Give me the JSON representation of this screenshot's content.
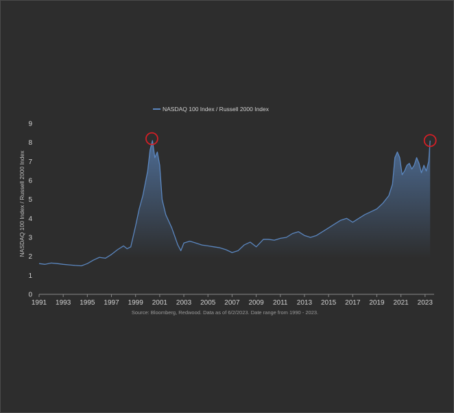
{
  "chart_data": {
    "type": "area",
    "title": "",
    "xlabel": "",
    "ylabel": "NASDAQ 100 Index / Russell 2000 Index",
    "xlim": [
      1991,
      2023.75
    ],
    "ylim": [
      0,
      9
    ],
    "x_ticks": [
      "1991",
      "1993",
      "1995",
      "1997",
      "1999",
      "2001",
      "2003",
      "2005",
      "2007",
      "2009",
      "2011",
      "2013",
      "2015",
      "2017",
      "2019",
      "2021",
      "2023"
    ],
    "y_ticks": [
      "0",
      "1",
      "2",
      "3",
      "4",
      "5",
      "6",
      "7",
      "8",
      "9"
    ],
    "grid": false,
    "legend": "top-center",
    "source": "Source: Bloomberg, Redwood. Data as of 6/2/2023. Date range from 1990 - 2023.",
    "series": [
      {
        "name": "NASDAQ 100 Index / Russell 2000 Index",
        "color": "#5b87c0",
        "x": [
          1991.0,
          1991.5,
          1992.0,
          1992.5,
          1993.0,
          1993.5,
          1994.0,
          1994.5,
          1995.0,
          1995.5,
          1996.0,
          1996.5,
          1997.0,
          1997.5,
          1998.0,
          1998.3,
          1998.6,
          1999.0,
          1999.3,
          1999.6,
          2000.0,
          2000.2,
          2000.4,
          2000.6,
          2000.8,
          2001.0,
          2001.2,
          2001.5,
          2002.0,
          2002.5,
          2002.75,
          2003.0,
          2003.5,
          2004.0,
          2004.5,
          2005.0,
          2005.5,
          2006.0,
          2006.5,
          2007.0,
          2007.5,
          2008.0,
          2008.5,
          2009.0,
          2009.3,
          2009.6,
          2010.0,
          2010.5,
          2011.0,
          2011.5,
          2012.0,
          2012.5,
          2013.0,
          2013.5,
          2014.0,
          2014.5,
          2015.0,
          2015.5,
          2016.0,
          2016.5,
          2017.0,
          2017.5,
          2018.0,
          2018.5,
          2019.0,
          2019.5,
          2020.0,
          2020.3,
          2020.5,
          2020.7,
          2020.9,
          2021.1,
          2021.3,
          2021.5,
          2021.7,
          2021.9,
          2022.1,
          2022.3,
          2022.5,
          2022.7,
          2022.9,
          2023.1,
          2023.3,
          2023.42
        ],
        "values": [
          1.62,
          1.58,
          1.65,
          1.62,
          1.58,
          1.55,
          1.52,
          1.5,
          1.62,
          1.8,
          1.95,
          1.9,
          2.1,
          2.35,
          2.55,
          2.4,
          2.5,
          3.6,
          4.5,
          5.2,
          6.5,
          7.6,
          8.1,
          7.2,
          7.5,
          6.8,
          5.0,
          4.2,
          3.5,
          2.6,
          2.3,
          2.7,
          2.8,
          2.7,
          2.6,
          2.55,
          2.5,
          2.45,
          2.35,
          2.2,
          2.3,
          2.6,
          2.75,
          2.5,
          2.7,
          2.9,
          2.9,
          2.85,
          2.95,
          3.0,
          3.2,
          3.3,
          3.1,
          3.0,
          3.1,
          3.3,
          3.5,
          3.7,
          3.9,
          4.0,
          3.8,
          4.0,
          4.2,
          4.35,
          4.5,
          4.8,
          5.2,
          5.8,
          7.2,
          7.5,
          7.2,
          6.3,
          6.5,
          6.8,
          6.9,
          6.6,
          6.8,
          7.2,
          6.9,
          6.4,
          6.8,
          6.5,
          7.0,
          8.1
        ]
      }
    ],
    "annotations": [
      {
        "type": "circle",
        "color": "#d41f26",
        "x": 2000.35,
        "y": 8.2
      },
      {
        "type": "circle",
        "color": "#d41f26",
        "x": 2023.42,
        "y": 8.1
      }
    ]
  }
}
